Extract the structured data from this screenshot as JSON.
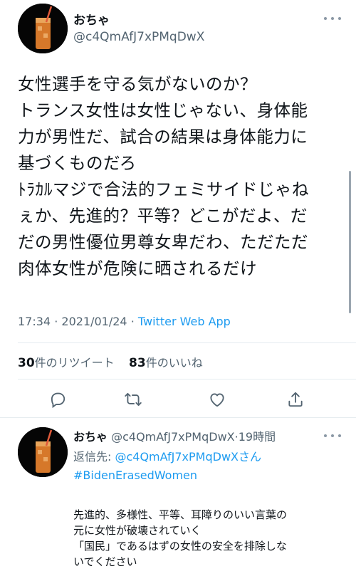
{
  "tweet": {
    "author_name": "おちゃ",
    "author_handle": "@c4QmAfJ7xPMqDwX",
    "text_lines": [
      "女性選手を守る気がないのか？",
      "トランス女性は女性じゃない、身体能",
      "力が男性だ、試合の結果は身体能力に",
      "基づくものだろ",
      "ﾄﾗｶﾙマジで合法的フェミサイドじゃね",
      "ぇか、先進的？平等？どこがだよ、だ",
      "だの男性優位男尊女卑だわ、ただただ",
      "肉体女性が危険に晒されるだけ"
    ],
    "time": "17:34",
    "date": "2021/01/24",
    "separator": "·",
    "app": "Twitter Web App",
    "retweet_count": "30",
    "retweet_label": "件のリツイート",
    "like_count": "83",
    "like_label": "件のいいね",
    "actions": [
      "reply-icon",
      "retweet-icon",
      "like-icon",
      "share-icon"
    ]
  },
  "reply": {
    "author_name": "おちゃ",
    "author_handle": "@c4QmAfJ7xPMqDwX",
    "separator": "·",
    "time_ago": "19時間",
    "reply_to_prefix": "返信先: ",
    "reply_to_handle": "@c4QmAfJ7xPMqDwXさん",
    "hashtag": "#BidenErasedWomen",
    "text_lines": [
      "先進的、多様性、平等、耳障りのいい言葉の",
      "元に女性が破壊されていく",
      "「国民」であるはずの女性の安全を排除しな",
      "いでください"
    ]
  },
  "colors": {
    "text": "#0f1419",
    "secondary": "#536471",
    "accent": "#1d9bf0",
    "divider": "#e6ecf0"
  }
}
